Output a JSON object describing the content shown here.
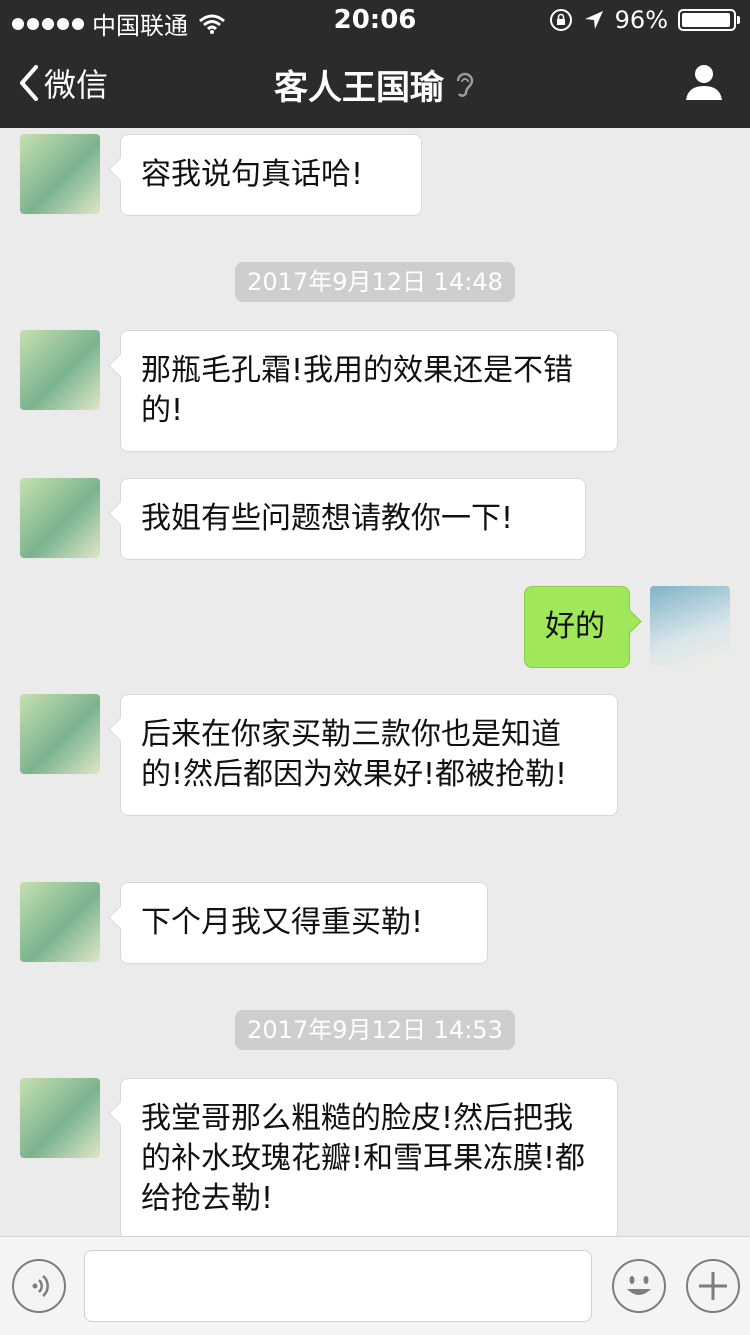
{
  "status_bar": {
    "carrier": "中国联通",
    "time": "20:06",
    "battery": "96%",
    "battery_level": 0.96,
    "icons": [
      "signal-dots-icon",
      "wifi-icon",
      "rotation-lock-icon",
      "location-arrow-icon",
      "battery-icon"
    ]
  },
  "nav": {
    "back_label": "微信",
    "title": "客人王国瑜",
    "icons": [
      "back-chevron-icon",
      "ear-icon",
      "profile-icon"
    ]
  },
  "messages": [
    {
      "side": "left",
      "text": "容我说句真话哈!"
    },
    {
      "timestamp": "2017年9月12日 14:48"
    },
    {
      "side": "left",
      "text": "那瓶毛孔霜!我用的效果还是不错的!"
    },
    {
      "side": "left",
      "text": "我姐有些问题想请教你一下!"
    },
    {
      "side": "right",
      "text": "好的"
    },
    {
      "side": "left",
      "text": "后来在你家买勒三款你也是知道的!然后都因为效果好!都被抢勒!"
    },
    {
      "side": "left",
      "text": "下个月我又得重买勒!"
    },
    {
      "timestamp": "2017年9月12日 14:53"
    },
    {
      "side": "left",
      "text": "我堂哥那么粗糙的脸皮!然后把我的补水玫瑰花瓣!和雪耳果冻膜!都给抢去勒!"
    }
  ],
  "input_bar": {
    "value": "",
    "icons": [
      "voice-icon",
      "emoji-icon",
      "plus-icon"
    ]
  },
  "colors": {
    "nav_bg": "#2b2b2d",
    "chat_bg": "#ebebeb",
    "right_bubble": "#a0e75a",
    "left_bubble": "#ffffff",
    "timestamp_bg": "#cecece"
  }
}
